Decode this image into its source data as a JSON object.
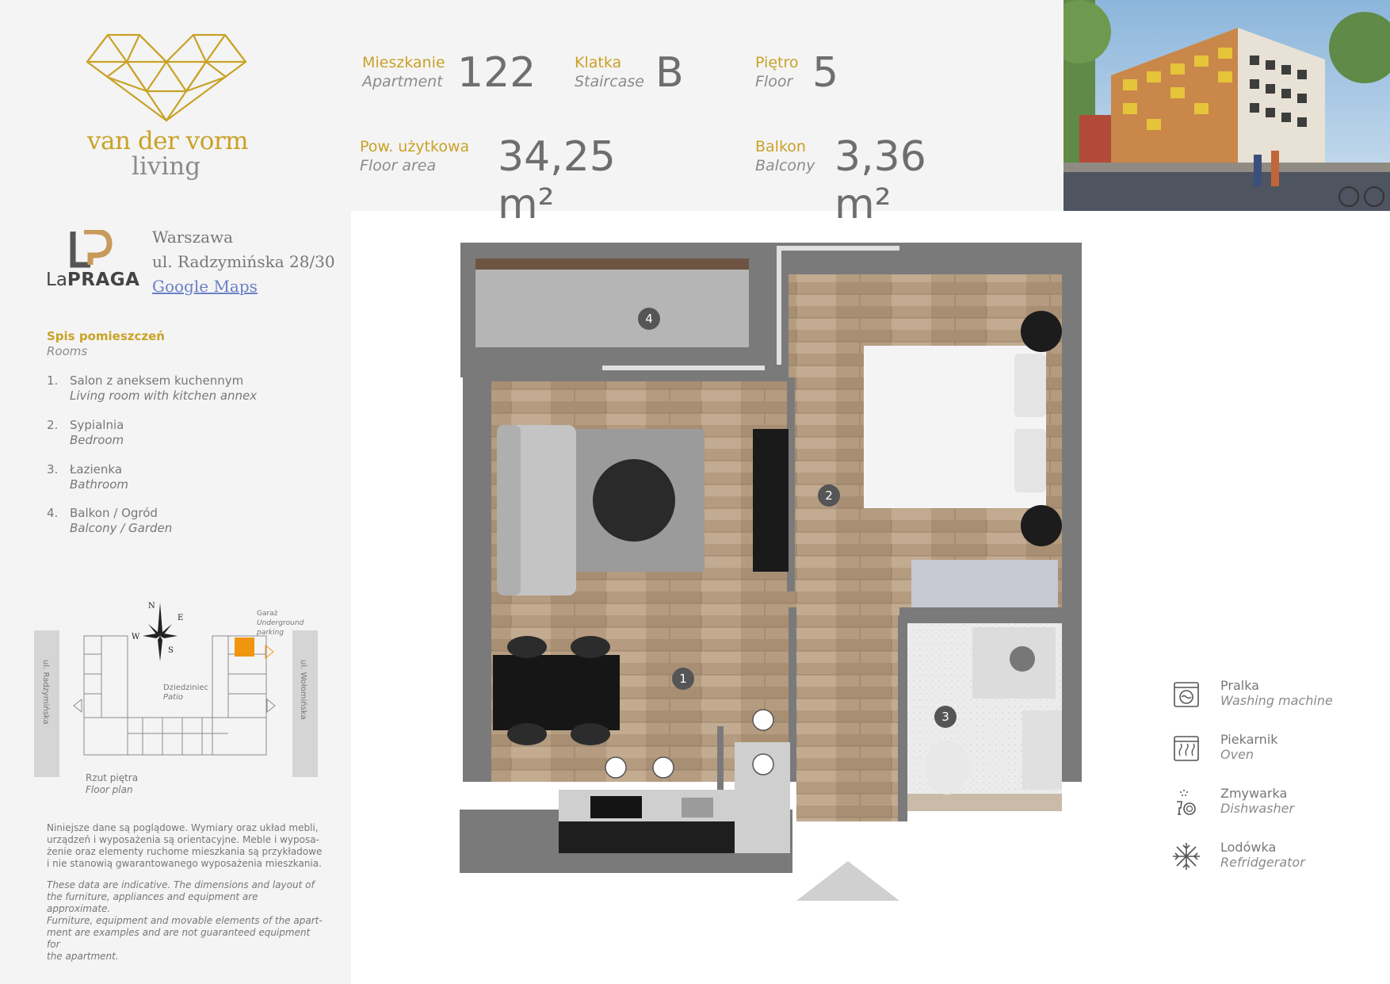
{
  "brand": {
    "line1": "van der vorm",
    "line2": "living",
    "gold": "#c9a227",
    "grey": "#8b8b8b"
  },
  "stats": {
    "apartment": {
      "pl": "Mieszkanie",
      "en": "Apartment",
      "value": "122"
    },
    "staircase": {
      "pl": "Klatka",
      "en": "Staircase",
      "value": "B"
    },
    "floor": {
      "pl": "Piętro",
      "en": "Floor",
      "value": "5"
    },
    "area": {
      "pl": "Pow. użytkowa",
      "en": "Floor area",
      "value": "34,25 m²"
    },
    "balcony": {
      "pl": "Balkon",
      "en": "Balcony",
      "value": "3,36 m²"
    }
  },
  "project": {
    "logo_pre": "La",
    "logo_main": "PRAGA",
    "city": "Warszawa",
    "street": "ul. Radzymińska 28/30",
    "map_link": "Google Maps"
  },
  "rooms": {
    "title": "Spis pomieszczeń",
    "subtitle": "Rooms",
    "items": [
      {
        "num": "1.",
        "pl": "Salon z aneksem kuchennym",
        "en": "Living room with kitchen annex"
      },
      {
        "num": "2.",
        "pl": "Sypialnia",
        "en": "Bedroom"
      },
      {
        "num": "3.",
        "pl": "Łazienka",
        "en": "Bathroom"
      },
      {
        "num": "4.",
        "pl": "Balkon / Ogród",
        "en": "Balcony / Garden"
      }
    ]
  },
  "minimap": {
    "street_left": "ul. Radzymińska",
    "street_right": "ul. Wołomińska",
    "garage_pl": "Garaż",
    "garage_en1": "Underground",
    "garage_en2": "parking",
    "patio_pl": "Dziedziniec",
    "patio_en": "Patio",
    "floorplan_pl": "Rzut piętra",
    "floorplan_en": "Floor plan",
    "compass_n": "N",
    "compass_e": "E",
    "compass_s": "S",
    "compass_w": "W",
    "highlight_color": "#f0960e"
  },
  "disclaimer": {
    "pl": [
      "Niniejsze dane są poglądowe. Wymiary oraz układ mebli,",
      "urządzeń i wyposażenia są orientacyjne. Meble i wyposa-",
      "żenie oraz elementy ruchome mieszkania są przykładowe",
      "i nie stanowią gwarantowanego wyposażenia mieszkania."
    ],
    "en": [
      "These data are indicative. The dimensions and layout of",
      "the furniture, appliances and equipment are approximate.",
      "Furniture, equipment and movable elements of the apart-",
      "ment are examples and are not guaranteed equipment for",
      "the apartment."
    ]
  },
  "plan_labels": {
    "r1": "1",
    "r2": "2",
    "r3": "3",
    "r4": "4"
  },
  "legend": [
    {
      "pl": "Pralka",
      "en": "Washing machine",
      "icon": "washing-machine-icon"
    },
    {
      "pl": "Piekarnik",
      "en": "Oven",
      "icon": "oven-icon"
    },
    {
      "pl": "Zmywarka",
      "en": "Dishwasher",
      "icon": "dishwasher-icon"
    },
    {
      "pl": "Lodówka",
      "en": "Refridgerator",
      "icon": "snowflake-icon"
    }
  ]
}
